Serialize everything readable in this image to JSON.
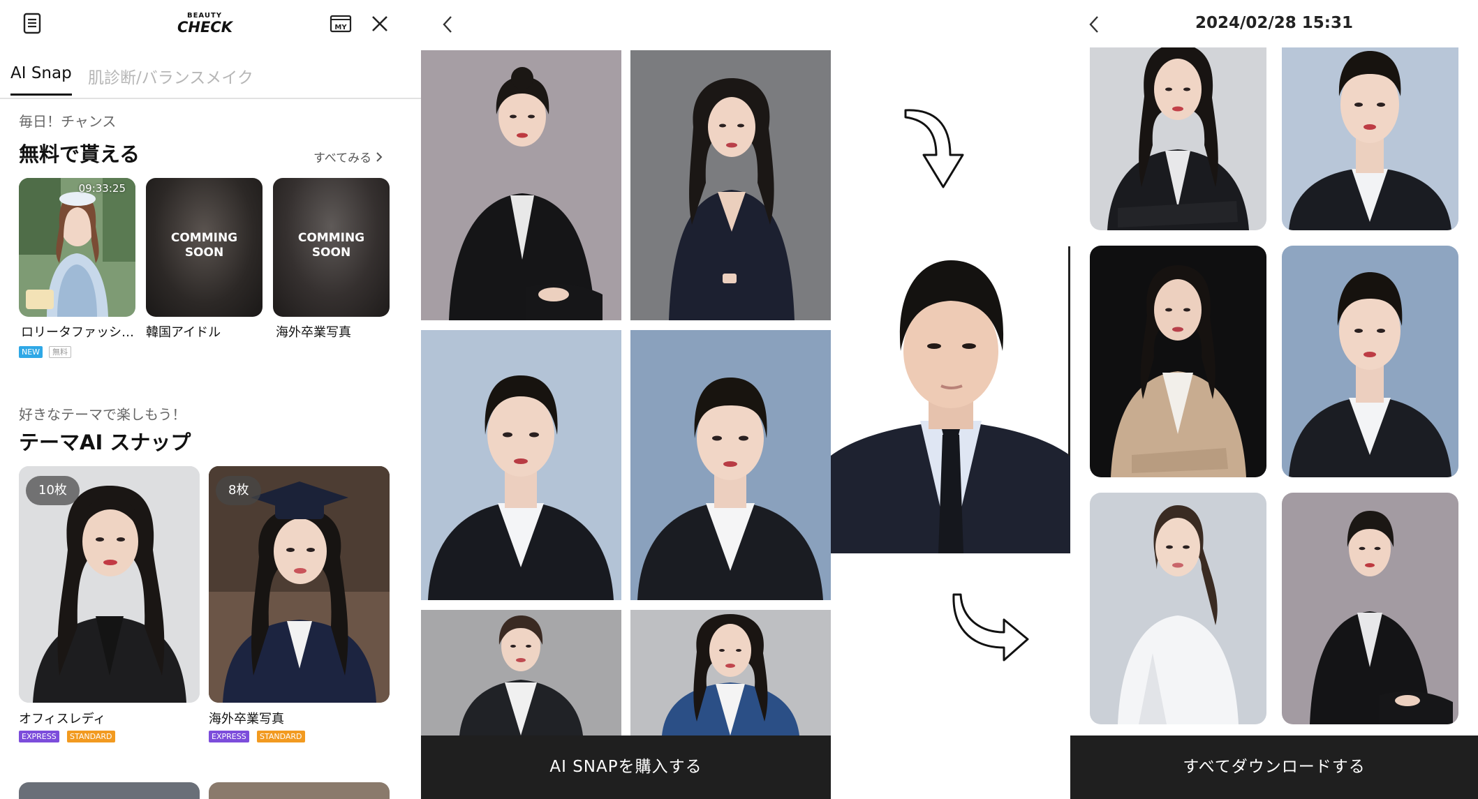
{
  "app": {
    "logo_top": "BEAUTY",
    "logo_main": "CHECK"
  },
  "tabs": [
    {
      "label": "AI Snap",
      "active": true
    },
    {
      "label": "肌診断/バランスメイク",
      "active": false
    }
  ],
  "free_section": {
    "subtitle": "毎日！チャンス",
    "title": "無料で貰える",
    "see_all": "すべてみる",
    "cards": [
      {
        "label": "ロリータファッシ…",
        "timer": "09:33:25",
        "badges": [
          "NEW",
          "無料"
        ]
      },
      {
        "label": "韓国アイドル",
        "overlay": [
          "COMMING",
          "SOON"
        ]
      },
      {
        "label": "海外卒業写真",
        "overlay": [
          "COMMING",
          "SOON"
        ]
      }
    ]
  },
  "theme_section": {
    "subtitle": "好きなテーマで楽しもう！",
    "title": "テーマAI スナップ",
    "cards": [
      {
        "label": "オフィスレディ",
        "count": "10枚",
        "badges": [
          "EXPRESS",
          "STANDARD"
        ]
      },
      {
        "label": "海外卒業写真",
        "count": "8枚",
        "badges": [
          "EXPRESS",
          "STANDARD"
        ]
      }
    ]
  },
  "preview_panel": {
    "buy_button": "AI SNAPを購入する"
  },
  "result_panel": {
    "datetime": "2024/02/28 15:31",
    "download_button": "すべてダウンロードする"
  },
  "icons": [
    "receipt-icon",
    "my-page-icon",
    "close-icon",
    "chevron-right-icon",
    "back-arrow-icon",
    "curved-arrow-down-icon",
    "curved-arrow-right-icon"
  ],
  "colors": {
    "badge_new": "#2fa8e6",
    "badge_express": "#7c4ddb",
    "badge_standard": "#f29a20",
    "bottom_bar": "#1f1f1f"
  }
}
